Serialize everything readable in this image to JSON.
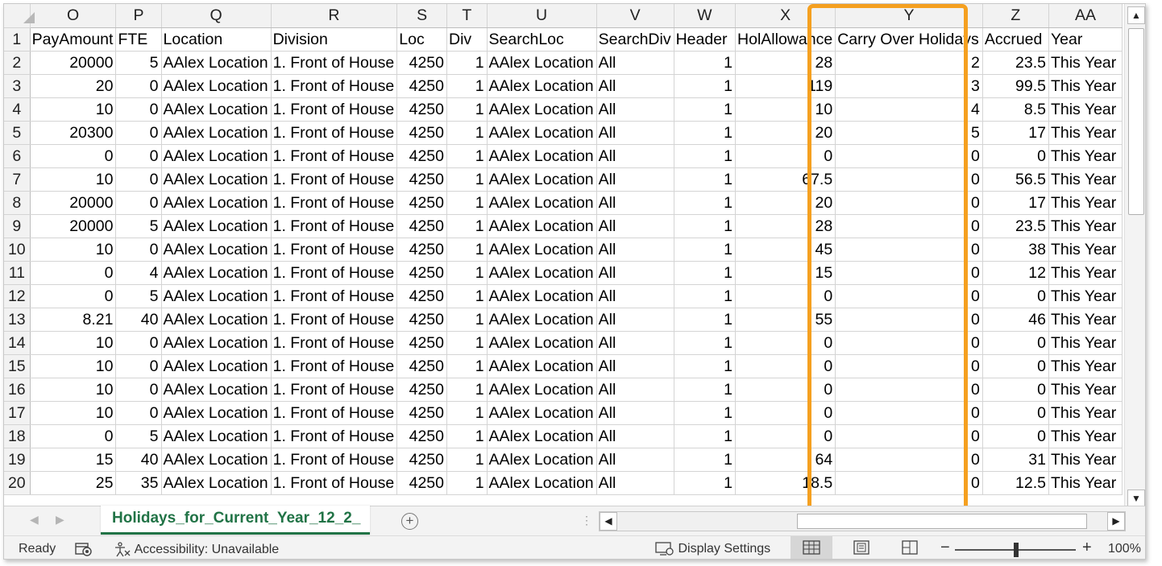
{
  "grid": {
    "columns": [
      "O",
      "P",
      "Q",
      "R",
      "S",
      "T",
      "U",
      "V",
      "W",
      "X",
      "Y",
      "Z",
      "AA"
    ],
    "headers": [
      "PayAmount",
      "FTE",
      "Location",
      "Division",
      "Loc",
      "Div",
      "SearchLoc",
      "SearchDiv",
      "Header",
      "HolAllowance",
      "Carry Over Holidays",
      "Accrued",
      "Year"
    ],
    "rows": [
      {
        "n": "2",
        "v": [
          "20000",
          "5",
          "AAlex Location",
          "1. Front of House",
          "4250",
          "1",
          "AAlex Location",
          "All",
          "1",
          "28",
          "2",
          "23.5",
          "This Year"
        ]
      },
      {
        "n": "3",
        "v": [
          "20",
          "0",
          "AAlex Location",
          "1. Front of House",
          "4250",
          "1",
          "AAlex Location",
          "All",
          "1",
          "119",
          "3",
          "99.5",
          "This Year"
        ]
      },
      {
        "n": "4",
        "v": [
          "10",
          "0",
          "AAlex Location",
          "1. Front of House",
          "4250",
          "1",
          "AAlex Location",
          "All",
          "1",
          "10",
          "4",
          "8.5",
          "This Year"
        ]
      },
      {
        "n": "5",
        "v": [
          "20300",
          "0",
          "AAlex Location",
          "1. Front of House",
          "4250",
          "1",
          "AAlex Location",
          "All",
          "1",
          "20",
          "5",
          "17",
          "This Year"
        ]
      },
      {
        "n": "6",
        "v": [
          "0",
          "0",
          "AAlex Location",
          "1. Front of House",
          "4250",
          "1",
          "AAlex Location",
          "All",
          "1",
          "0",
          "0",
          "0",
          "This Year"
        ]
      },
      {
        "n": "7",
        "v": [
          "10",
          "0",
          "AAlex Location",
          "1. Front of House",
          "4250",
          "1",
          "AAlex Location",
          "All",
          "1",
          "67.5",
          "0",
          "56.5",
          "This Year"
        ]
      },
      {
        "n": "8",
        "v": [
          "20000",
          "0",
          "AAlex Location",
          "1. Front of House",
          "4250",
          "1",
          "AAlex Location",
          "All",
          "1",
          "20",
          "0",
          "17",
          "This Year"
        ]
      },
      {
        "n": "9",
        "v": [
          "20000",
          "5",
          "AAlex Location",
          "1. Front of House",
          "4250",
          "1",
          "AAlex Location",
          "All",
          "1",
          "28",
          "0",
          "23.5",
          "This Year"
        ]
      },
      {
        "n": "10",
        "v": [
          "10",
          "0",
          "AAlex Location",
          "1. Front of House",
          "4250",
          "1",
          "AAlex Location",
          "All",
          "1",
          "45",
          "0",
          "38",
          "This Year"
        ]
      },
      {
        "n": "11",
        "v": [
          "0",
          "4",
          "AAlex Location",
          "1. Front of House",
          "4250",
          "1",
          "AAlex Location",
          "All",
          "1",
          "15",
          "0",
          "12",
          "This Year"
        ]
      },
      {
        "n": "12",
        "v": [
          "0",
          "5",
          "AAlex Location",
          "1. Front of House",
          "4250",
          "1",
          "AAlex Location",
          "All",
          "1",
          "0",
          "0",
          "0",
          "This Year"
        ]
      },
      {
        "n": "13",
        "v": [
          "8.21",
          "40",
          "AAlex Location",
          "1. Front of House",
          "4250",
          "1",
          "AAlex Location",
          "All",
          "1",
          "55",
          "0",
          "46",
          "This Year"
        ]
      },
      {
        "n": "14",
        "v": [
          "10",
          "0",
          "AAlex Location",
          "1. Front of House",
          "4250",
          "1",
          "AAlex Location",
          "All",
          "1",
          "0",
          "0",
          "0",
          "This Year"
        ]
      },
      {
        "n": "15",
        "v": [
          "10",
          "0",
          "AAlex Location",
          "1. Front of House",
          "4250",
          "1",
          "AAlex Location",
          "All",
          "1",
          "0",
          "0",
          "0",
          "This Year"
        ]
      },
      {
        "n": "16",
        "v": [
          "10",
          "0",
          "AAlex Location",
          "1. Front of House",
          "4250",
          "1",
          "AAlex Location",
          "All",
          "1",
          "0",
          "0",
          "0",
          "This Year"
        ]
      },
      {
        "n": "17",
        "v": [
          "10",
          "0",
          "AAlex Location",
          "1. Front of House",
          "4250",
          "1",
          "AAlex Location",
          "All",
          "1",
          "0",
          "0",
          "0",
          "This Year"
        ]
      },
      {
        "n": "18",
        "v": [
          "0",
          "5",
          "AAlex Location",
          "1. Front of House",
          "4250",
          "1",
          "AAlex Location",
          "All",
          "1",
          "0",
          "0",
          "0",
          "This Year"
        ]
      },
      {
        "n": "19",
        "v": [
          "15",
          "40",
          "AAlex Location",
          "1. Front of House",
          "4250",
          "1",
          "AAlex Location",
          "All",
          "1",
          "64",
          "0",
          "31",
          "This Year"
        ]
      },
      {
        "n": "20",
        "v": [
          "25",
          "35",
          "AAlex Location",
          "1. Front of House",
          "4250",
          "1",
          "AAlex Location",
          "All",
          "1",
          "18.5",
          "0",
          "12.5",
          "This Year"
        ]
      }
    ]
  },
  "tabs": {
    "active_sheet": "Holidays_for_Current_Year_12_2_"
  },
  "statusbar": {
    "ready": "Ready",
    "accessibility": "Accessibility: Unavailable",
    "display_settings": "Display Settings",
    "zoom": "100%"
  },
  "colors": {
    "highlight": "#f5a020",
    "sheet_tab": "#217346"
  }
}
